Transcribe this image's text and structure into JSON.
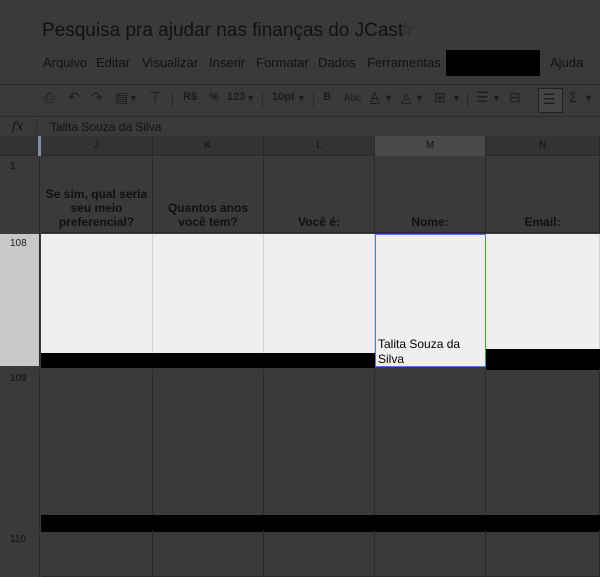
{
  "document": {
    "title": "Pesquisa pra ajudar nas finanças do JCast",
    "star_icon": "star-icon"
  },
  "menu": {
    "items": [
      "Arquivo",
      "Editar",
      "Visualizar",
      "Inserir",
      "Formatar",
      "Dados",
      "Ferramentas",
      "Ajuda"
    ]
  },
  "toolbar": {
    "currency": "R$",
    "percent": "%",
    "number_format": "123",
    "font_size": "10pt",
    "bold": "B",
    "strikethrough": "Abc",
    "text_color": "A",
    "sigma": "Σ",
    "icons": [
      "print-icon",
      "undo-icon",
      "redo-icon",
      "paint-format-icon",
      "paint-roller-icon",
      "text-color-icon",
      "fill-color-icon",
      "borders-icon",
      "align-icon",
      "merge-icon",
      "wrap-text-icon",
      "functions-icon"
    ]
  },
  "formula_bar": {
    "label": "fx",
    "value": "Talita Souza da Silva"
  },
  "columns": [
    "J",
    "K",
    "L",
    "M",
    "N"
  ],
  "header_row": {
    "number": "1",
    "cells": [
      "Se sim, qual seria seu meio preferencial?",
      "Quantos anos você tem?",
      "Você é:",
      "Nome:",
      "Email:"
    ]
  },
  "rows": [
    {
      "number": "108",
      "cells": [
        "",
        "",
        "",
        "Talita Souza da Silva",
        ""
      ]
    },
    {
      "number": "109",
      "cells": [
        "",
        "",
        "",
        "",
        ""
      ]
    },
    {
      "number": "110",
      "cells": [
        "",
        "",
        "",
        "",
        ""
      ]
    }
  ],
  "colors": {
    "selection": "#4d7bd6",
    "overlay": "#3a3a3a",
    "highlight_row": "#efefef"
  }
}
